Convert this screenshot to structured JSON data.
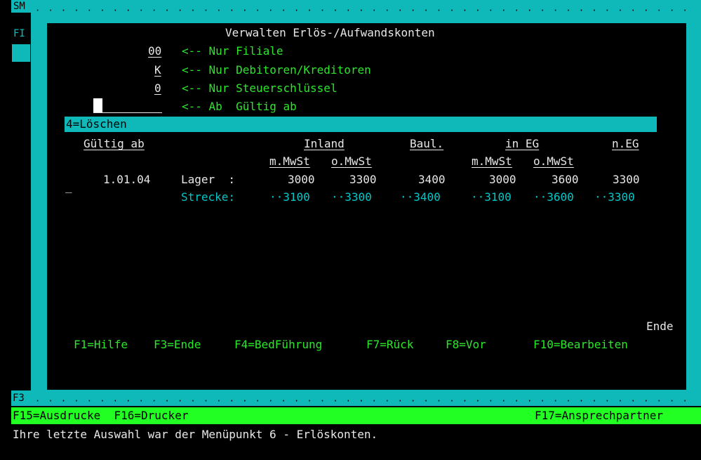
{
  "side": {
    "sm": "SM",
    "fi": "FI",
    "f3": "F3"
  },
  "window": {
    "title": "Verwalten Erlös-/Aufwandskonten",
    "filters": [
      {
        "value": "00",
        "label": "<-- Nur Filiale"
      },
      {
        "value": "K",
        "label": "<-- Nur Debitoren/Kreditoren"
      },
      {
        "value": "0",
        "label": "<-- Nur Steuerschlüssel"
      },
      {
        "value": "",
        "label": "<-- Ab  Gültig ab"
      }
    ],
    "options_bar": "4=Löschen",
    "headers": {
      "gueltig": "Gültig ab",
      "inland": "Inland",
      "baul": "Baul.",
      "ineg": "in EG",
      "neg": "n.EG",
      "mmwst1": "m.MwSt",
      "omwst1": "o.MwSt",
      "mmwst2": "m.MwSt",
      "omwst2": "o.MwSt"
    },
    "row": {
      "select": "_",
      "date": "1.01.04",
      "lager_label": "Lager  :",
      "lager": [
        "3000",
        "3300",
        "3400",
        "3000",
        "3600",
        "3300"
      ],
      "strecke_label": "Strecke:",
      "strecke": [
        "··3100",
        "··3300",
        "··3400",
        "··3100",
        "··3600",
        "··3300"
      ]
    },
    "ende": "Ende",
    "fkeys": [
      "F1=Hilfe",
      "F3=Ende",
      "F4=BedFührung",
      "F7=Rück",
      "F8=Vor",
      "F10=Bearbeiten"
    ]
  },
  "bottom_bar": {
    "left": "F15=Ausdrucke  F16=Drucker",
    "right": "F17=Ansprechpartner"
  },
  "message": "Ihre letzte Auswahl war der Menüpunkt 6 - Erlöskonten.",
  "colors": {
    "cyan": "#0fb9b9",
    "green": "#2ce62c",
    "bar_green": "#22ff22",
    "text": "#e8e8e8",
    "teal_text": "#00c8c8"
  }
}
